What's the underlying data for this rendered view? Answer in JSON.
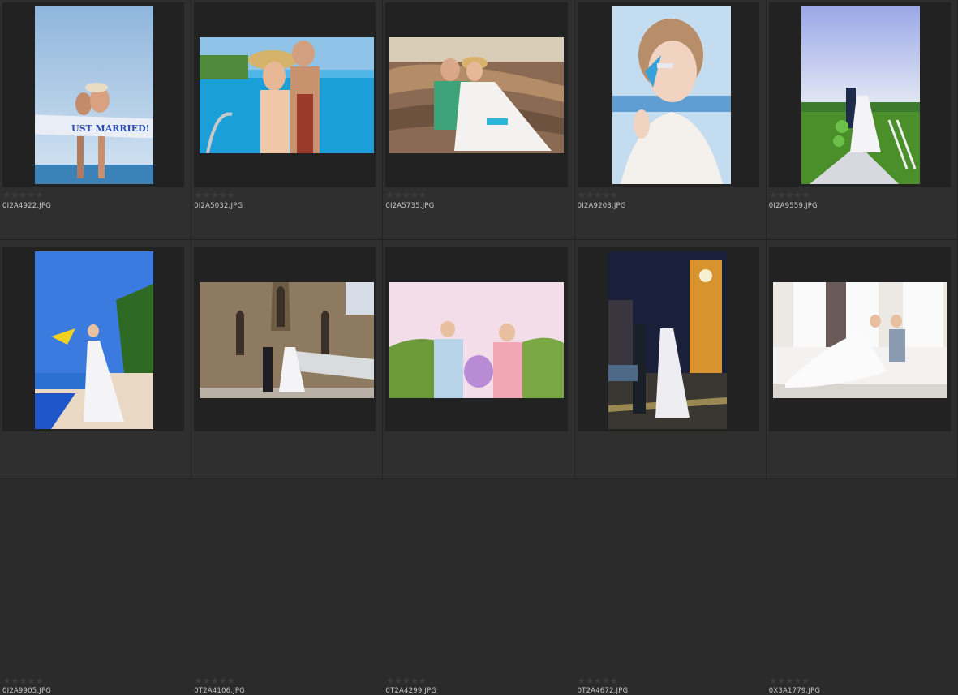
{
  "thumbnails": [
    {
      "filename": "0I2A4922.JPG",
      "rating": 0,
      "overlay_text": "UST MARRIED!",
      "colors": {
        "sky": "#a9c9e6",
        "sea": "#3a82b8"
      }
    },
    {
      "filename": "0I2A5032.JPG",
      "rating": 0,
      "colors": {
        "sky": "#8fc4e8",
        "water": "#1b9fd9"
      }
    },
    {
      "filename": "0I2A5735.JPG",
      "rating": 0,
      "colors": {
        "rock": "#8a6a52",
        "sky": "#e7e0d3"
      }
    },
    {
      "filename": "0I2A9203.JPG",
      "rating": 0,
      "colors": {
        "sky": "#c4dcf0",
        "dress": "#f2efec"
      }
    },
    {
      "filename": "0I2A9559.JPG",
      "rating": 0,
      "colors": {
        "sky": "#b7c6ee",
        "grass": "#4a8f2a"
      }
    },
    {
      "filename": "0I2A9905.JPG",
      "rating": 0,
      "colors": {
        "sky": "#3b7be0",
        "pool": "#1f57c8"
      }
    },
    {
      "filename": "0T2A4106.JPG",
      "rating": 0,
      "colors": {
        "stone": "#8d7a60",
        "sky": "#d6dde6"
      }
    },
    {
      "filename": "0T2A4299.JPG",
      "rating": 0,
      "colors": {
        "sky": "#f3dde8",
        "trees": "#6d9a3a"
      }
    },
    {
      "filename": "0T2A4672.JPG",
      "rating": 0,
      "colors": {
        "night": "#1a1f3a",
        "tower": "#e8a23a"
      }
    },
    {
      "filename": "0X3A1779.JPG",
      "rating": 0,
      "colors": {
        "room": "#ece8e4",
        "sofa": "#f4f2f0"
      }
    }
  ]
}
